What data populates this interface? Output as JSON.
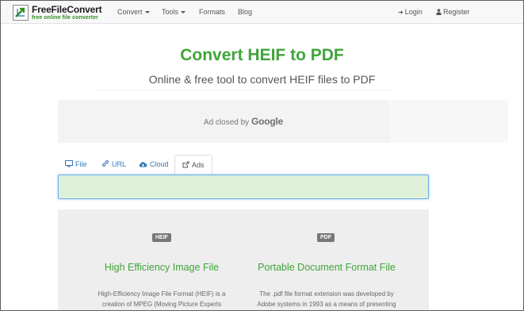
{
  "brand": {
    "name": "FreeFileConvert",
    "tagline": "free online file converter"
  },
  "nav": {
    "items": [
      {
        "label": "Convert",
        "has_dropdown": true
      },
      {
        "label": "Tools",
        "has_dropdown": true
      },
      {
        "label": "Formats",
        "has_dropdown": false
      },
      {
        "label": "Blog",
        "has_dropdown": false
      }
    ],
    "login_label": "Login",
    "register_label": "Register"
  },
  "hero": {
    "title": "Convert HEIF to PDF",
    "subtitle": "Online & free tool to convert HEIF files to PDF"
  },
  "ad": {
    "closed_text": "Ad closed by",
    "closed_brand": "Google"
  },
  "tabs": [
    {
      "label": "File",
      "icon": "monitor-icon",
      "active": false
    },
    {
      "label": "URL",
      "icon": "link-icon",
      "active": false
    },
    {
      "label": "Cloud",
      "icon": "cloud-icon",
      "active": false
    },
    {
      "label": "Ads",
      "icon": "external-link-icon",
      "active": true
    }
  ],
  "formats": {
    "from": {
      "badge": "HEIF",
      "title": "High Efficiency Image File",
      "description": "High-Efficiency Image File Format (HEIF) is a creation of MPEG (Moving Picture Experts"
    },
    "to": {
      "badge": "PDF",
      "title": "Portable Document Format File",
      "description": "The .pdf file format extension was developed by Adobe systems in 1993 as a means of presenting"
    }
  },
  "colors": {
    "accent_green": "#40a53a",
    "link_blue": "#337ab7",
    "upload_bg": "#dff0d8",
    "upload_border": "#66afe9"
  }
}
